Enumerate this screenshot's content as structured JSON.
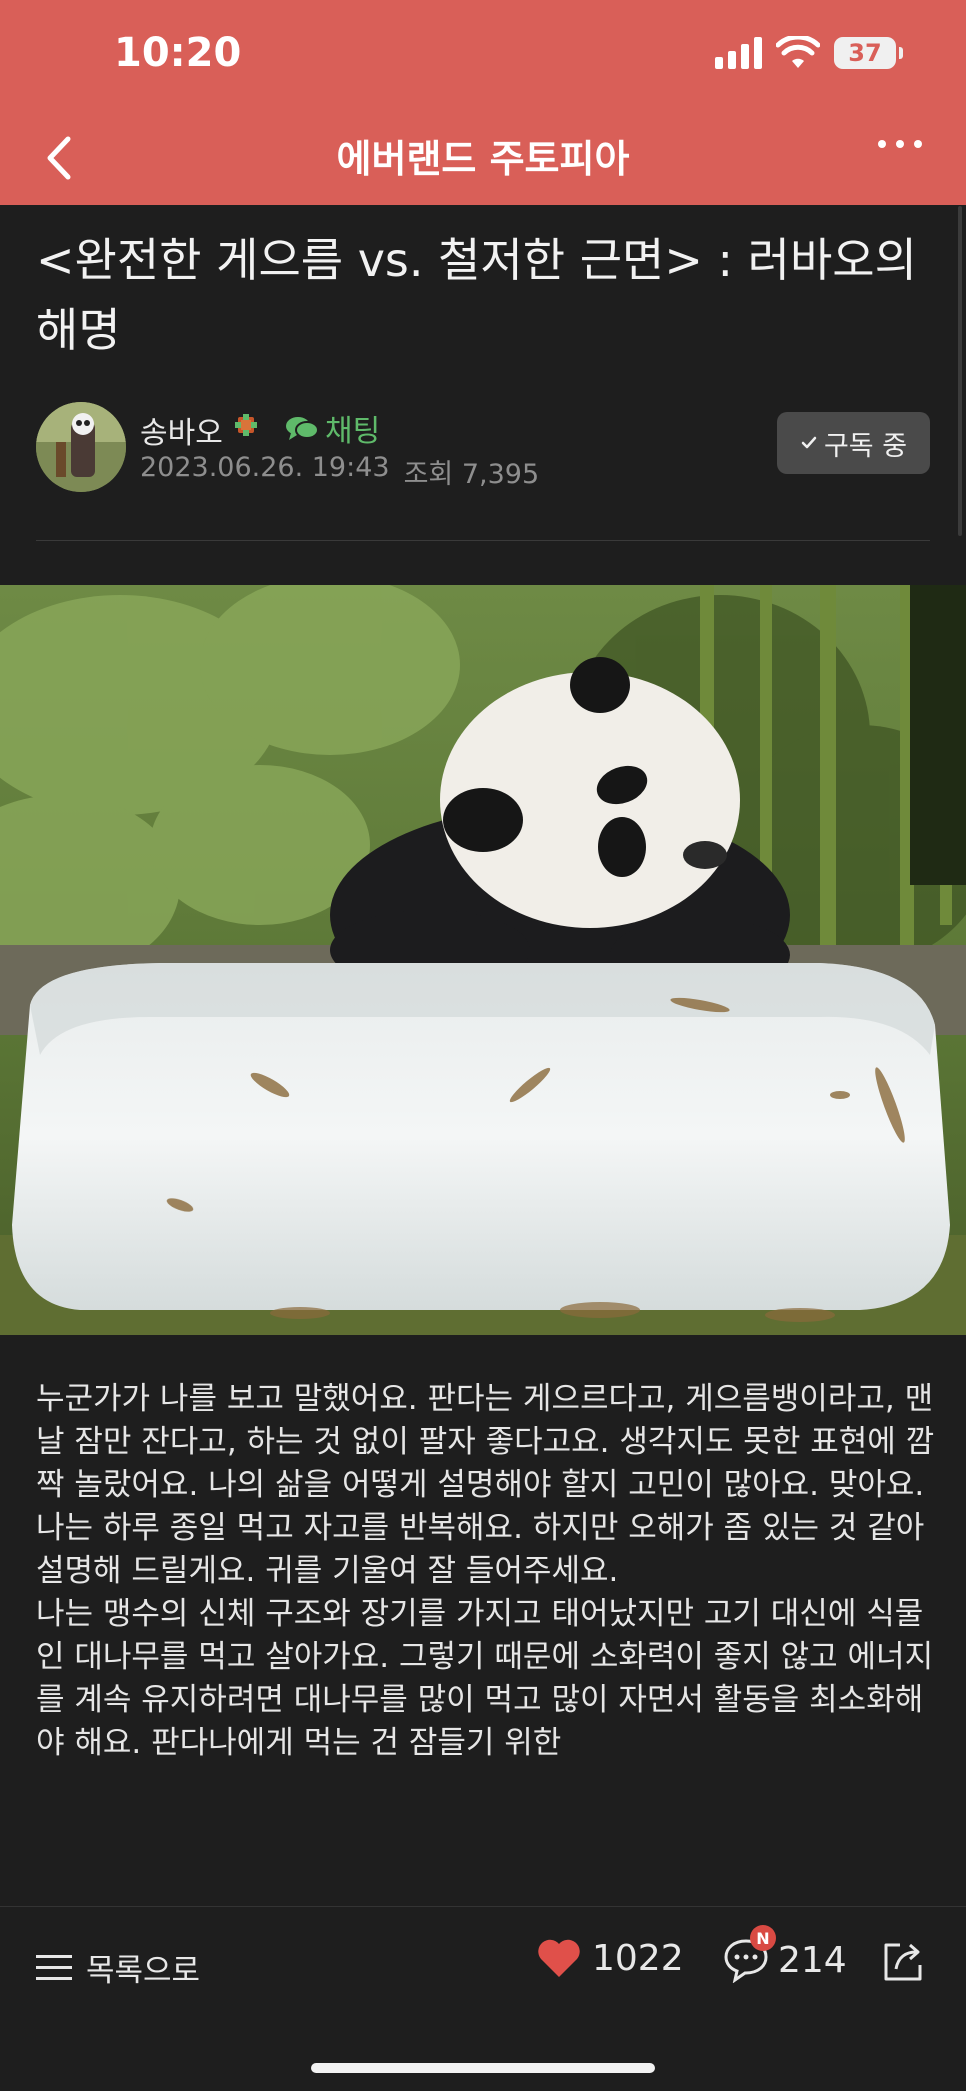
{
  "status_bar": {
    "time": "10:20",
    "battery": "37"
  },
  "header": {
    "title": "에버랜드 주토피아"
  },
  "article": {
    "title": "<완전한 게으름 vs. 철저한 근면> : 러바오의 해명",
    "author": "송바오",
    "chat_label": "채팅",
    "date": "2023.06.26. 19:43",
    "views": "조회 7,395",
    "subscribe_label": "구독 중",
    "paragraphs": [
      " 누군가가 나를 보고 말했어요. 판다는 게으르다고, 게으름뱅이라고, 맨날 잠만 잔다고, 하는 것 없이 팔자 좋다고요. 생각지도 못한 표현에 깜짝 놀랐어요. 나의 삶을 어떻게 설명해야 할지 고민이 많아요. 맞아요. 나는 하루 종일 먹고 자고를 반복해요. 하지만 오해가 좀 있는 것 같아 설명해 드릴게요. 귀를 기울여 잘 들어주세요.",
      "나는 맹수의 신체 구조와 장기를 가지고 태어났지만 고기 대신에 식물인 대나무를 먹고 살아가요. 그렇기 때문에 소화력이 좋지 않고 에너지를 계속 유지하려면 대나무를 많이 먹고 많이 자면서 활동을 최소화해야 해요. 판다나에게 먹는 건 잠들기 위한"
    ]
  },
  "bottom_bar": {
    "list_label": "목록으로",
    "like_count": "1022",
    "comment_count": "214",
    "new_badge": "N"
  },
  "colors": {
    "accent": "#d95f58",
    "chat_green": "#5fba6a",
    "heart": "#e0504a"
  }
}
